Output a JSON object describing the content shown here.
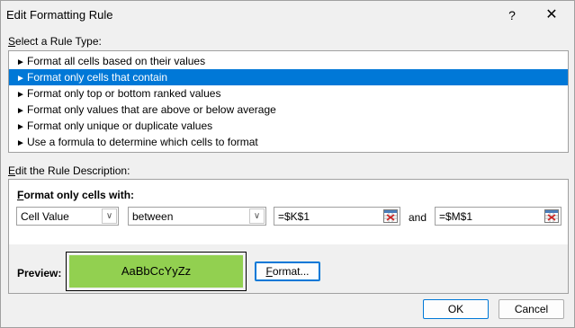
{
  "window": {
    "title": "Edit Formatting Rule",
    "help_label": "?",
    "close_label": "✕"
  },
  "rule_type": {
    "label_prefix": "S",
    "label_rest": "elect a Rule Type:",
    "items": [
      {
        "label": "Format all cells based on their values",
        "selected": false
      },
      {
        "label": "Format only cells that contain",
        "selected": true
      },
      {
        "label": "Format only top or bottom ranked values",
        "selected": false
      },
      {
        "label": "Format only values that are above or below average",
        "selected": false
      },
      {
        "label": "Format only unique or duplicate values",
        "selected": false
      },
      {
        "label": "Use a formula to determine which cells to format",
        "selected": false
      }
    ],
    "arrow_glyph": "►"
  },
  "description": {
    "label_prefix": "E",
    "label_rest": "dit the Rule Description:",
    "format_label_prefix": "F",
    "format_label_rest": "ormat only cells with:",
    "cell_condition": "Cell Value",
    "operator": "between",
    "value1": "=$K$1",
    "and_label": "and",
    "value2": "=$M$1",
    "dropdown_glyph": "∨"
  },
  "preview": {
    "label": "Preview:",
    "sample_text": "AaBbCcYyZz",
    "fill_color": "#92d050",
    "format_button_prefix": "F",
    "format_button_rest": "ormat..."
  },
  "buttons": {
    "ok": "OK",
    "cancel": "Cancel"
  }
}
